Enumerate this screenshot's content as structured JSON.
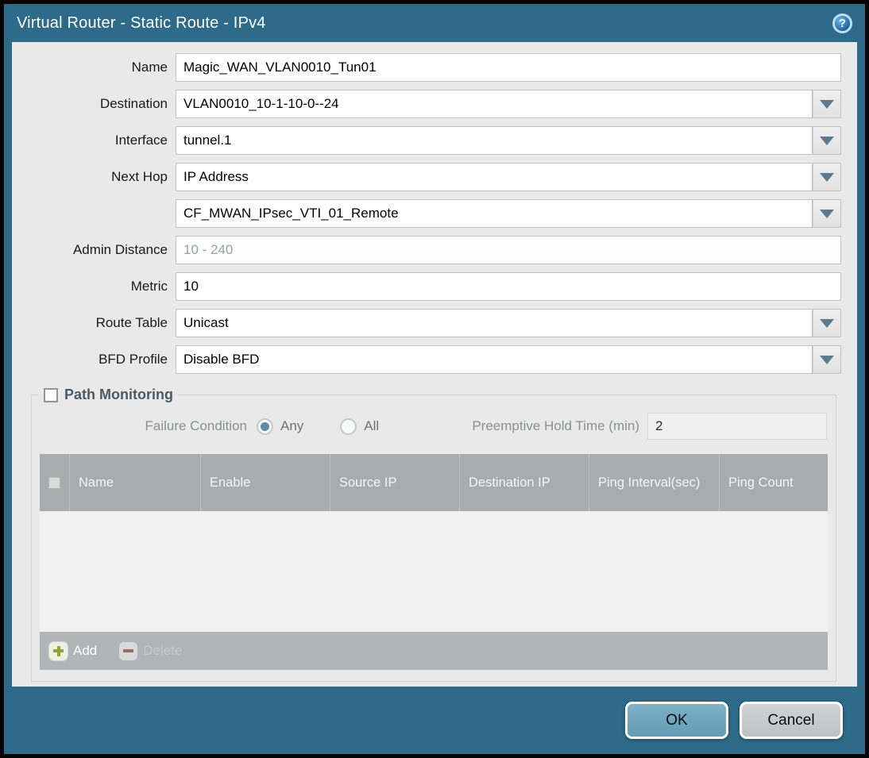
{
  "dialog": {
    "title": "Virtual Router - Static Route - IPv4",
    "help_glyph": "?"
  },
  "form": {
    "name": {
      "label": "Name",
      "value": "Magic_WAN_VLAN0010_Tun01"
    },
    "destination": {
      "label": "Destination",
      "value": "VLAN0010_10-1-10-0--24"
    },
    "interface": {
      "label": "Interface",
      "value": "tunnel.1"
    },
    "next_hop": {
      "label": "Next Hop",
      "value": "IP Address"
    },
    "next_hop_address": {
      "value": "CF_MWAN_IPsec_VTI_01_Remote"
    },
    "admin_distance": {
      "label": "Admin Distance",
      "placeholder": "10 - 240",
      "value": ""
    },
    "metric": {
      "label": "Metric",
      "value": "10"
    },
    "route_table": {
      "label": "Route Table",
      "value": "Unicast"
    },
    "bfd_profile": {
      "label": "BFD Profile",
      "value": "Disable BFD"
    }
  },
  "path_monitoring": {
    "title": "Path Monitoring",
    "enabled": false,
    "failure_condition": {
      "label": "Failure Condition",
      "options": [
        {
          "label": "Any",
          "selected": true
        },
        {
          "label": "All",
          "selected": false
        }
      ]
    },
    "preemptive_hold_time": {
      "label": "Preemptive Hold Time (min)",
      "value": "2"
    },
    "table": {
      "columns": [
        "Name",
        "Enable",
        "Source IP",
        "Destination IP",
        "Ping Interval(sec)",
        "Ping Count"
      ],
      "rows": []
    },
    "actions": {
      "add": "Add",
      "delete": "Delete",
      "delete_enabled": false
    }
  },
  "footer": {
    "ok": "OK",
    "cancel": "Cancel"
  },
  "colors": {
    "titlebar": "#2e6b8a",
    "table_header": "#a9acad",
    "ok_button": "#72a7bf",
    "accent_radio": "#5e8ca2",
    "content_bg": "#e9e9e9"
  }
}
